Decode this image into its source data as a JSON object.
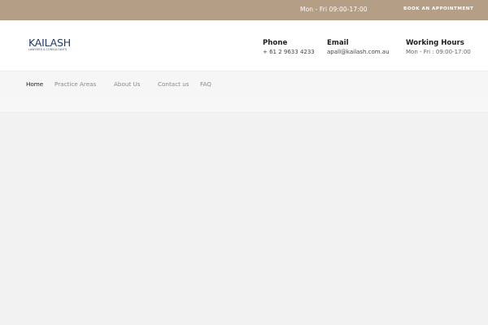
{
  "topbar": {
    "hours": "Mon - Fri 09:00-17:00",
    "cta_label": "BOOK AN APPOINTMENT",
    "background_color": "#b49e86"
  },
  "logo": {
    "name": "KAILASH",
    "tagline": "LAWYERS & CONSULTANTS",
    "color": "#1f3a66"
  },
  "contact": {
    "phone_label": "Phone",
    "phone_value": "+ 61 2 9633 4233",
    "email_label": "Email",
    "email_value": "apall@kailash.com.au",
    "hours_label": "Working Hours",
    "hours_value": "Mon - Fri : 09:00-17:00"
  },
  "nav": {
    "items": [
      {
        "label": "Home",
        "active": true
      },
      {
        "label": "Practice Areas",
        "active": false
      },
      {
        "label": "About Us",
        "active": false
      },
      {
        "label": "Contact us",
        "active": false
      },
      {
        "label": "FAQ",
        "active": false
      }
    ]
  }
}
